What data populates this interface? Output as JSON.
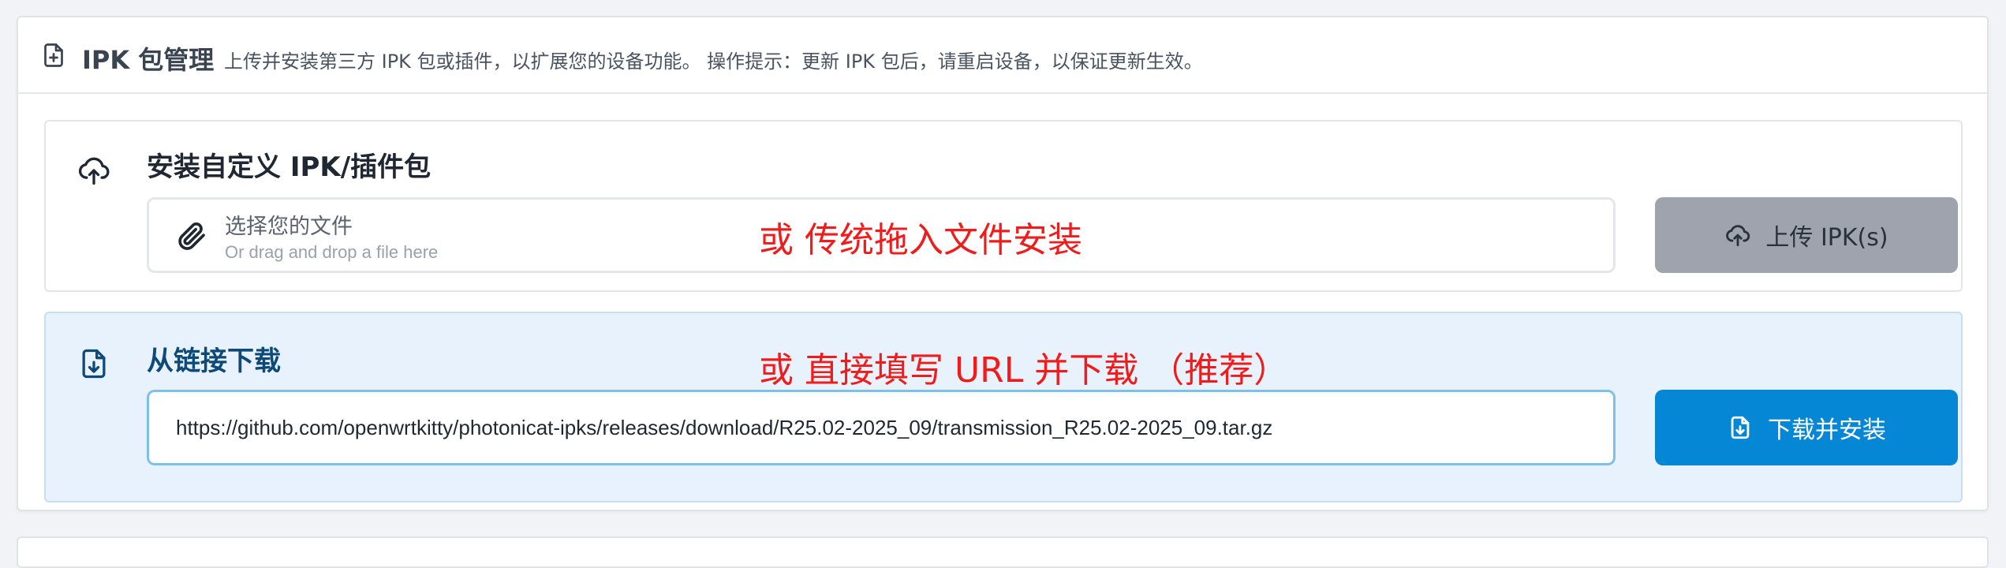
{
  "header": {
    "icon": "file-plus-icon",
    "title": "IPK 包管理",
    "description": "上传并安装第三方 IPK 包或插件，以扩展您的设备功能。 操作提示：更新 IPK 包后，请重启设备，以保证更新生效。"
  },
  "upload": {
    "icon": "cloud-upload-icon",
    "title": "安装自定义 IPK/插件包",
    "file_icon": "paperclip-icon",
    "file_label": "选择您的文件",
    "file_hint": "Or drag and drop a file here",
    "button_icon": "cloud-upload-icon",
    "button_label": "上传 IPK(s)",
    "annotation": "或 传统拖入文件安装",
    "annotation_color": "#f01c1c"
  },
  "download": {
    "icon": "file-download-icon",
    "title": "从链接下载",
    "url_value": "https://github.com/openwrtkitty/photonicat-ipks/releases/download/R25.02-2025_09/transmission_R25.02-2025_09.tar.gz",
    "button_icon": "file-download-icon",
    "button_label": "下载并安装",
    "annotation": "或 直接填写 URL 并下载 （推荐）",
    "annotation_color": "#f01c1c",
    "accent": "#0687d5"
  }
}
